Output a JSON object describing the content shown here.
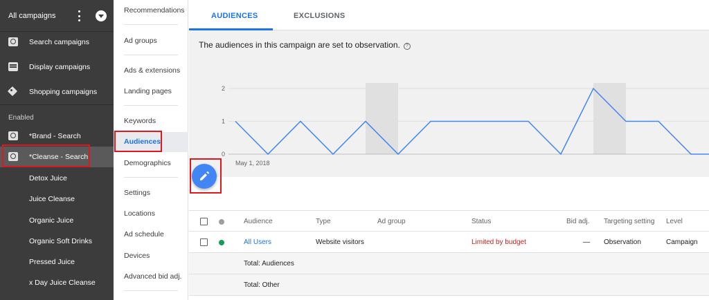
{
  "sidebar": {
    "header_title": "All campaigns",
    "items": [
      {
        "label": "Search campaigns",
        "icon": "search-icon"
      },
      {
        "label": "Display campaigns",
        "icon": "display-icon"
      },
      {
        "label": "Shopping campaigns",
        "icon": "tag-icon"
      }
    ],
    "enabled_label": "Enabled",
    "campaigns": [
      {
        "label": "*Brand - Search",
        "icon": "search-icon"
      },
      {
        "label": "*Cleanse - Search",
        "icon": "search-icon"
      }
    ],
    "ad_groups": [
      "Detox Juice",
      "Juice Cleanse",
      "Organic Juice",
      "Organic Soft Drinks",
      "Pressed Juice",
      "x Day Juice Cleanse"
    ]
  },
  "nav": {
    "items": [
      "Recommendations",
      "Ad groups",
      "Ads & extensions",
      "Landing pages",
      "Keywords",
      "Audiences",
      "Demographics",
      "Settings",
      "Locations",
      "Ad schedule",
      "Devices",
      "Advanced bid adj."
    ],
    "active": "Audiences"
  },
  "tabs": {
    "audiences": "AUDIENCES",
    "exclusions": "EXCLUSIONS"
  },
  "info_text": "The audiences in this campaign are set to observation.",
  "chart_data": {
    "type": "line",
    "yticks": [
      "2",
      "1",
      "0"
    ],
    "ylim": [
      0,
      2
    ],
    "x_start_label": "May 1, 2018",
    "values": [
      1,
      0,
      1,
      0,
      1,
      0,
      1,
      1,
      1,
      1,
      0,
      2,
      1,
      1,
      0,
      0,
      0.5
    ],
    "shaded_bands": [
      [
        4,
        5
      ],
      [
        11,
        12
      ]
    ],
    "line_color": "#4285f4"
  },
  "table": {
    "headers": {
      "audience": "Audience",
      "type": "Type",
      "ad_group": "Ad group",
      "status": "Status",
      "bid_adj": "Bid adj.",
      "targeting": "Targeting setting",
      "level": "Level"
    },
    "row": {
      "audience": "All Users",
      "type": "Website visitors",
      "status": "Limited by budget",
      "bid_adj": "—",
      "targeting": "Observation",
      "level": "Campaign"
    },
    "totals": [
      "Total: Audiences",
      "Total: Other"
    ]
  },
  "colors": {
    "accent": "#1a73e8",
    "status_warning": "#c5221f",
    "status_dot": "#0f9d58",
    "highlight": "#e0181e"
  }
}
